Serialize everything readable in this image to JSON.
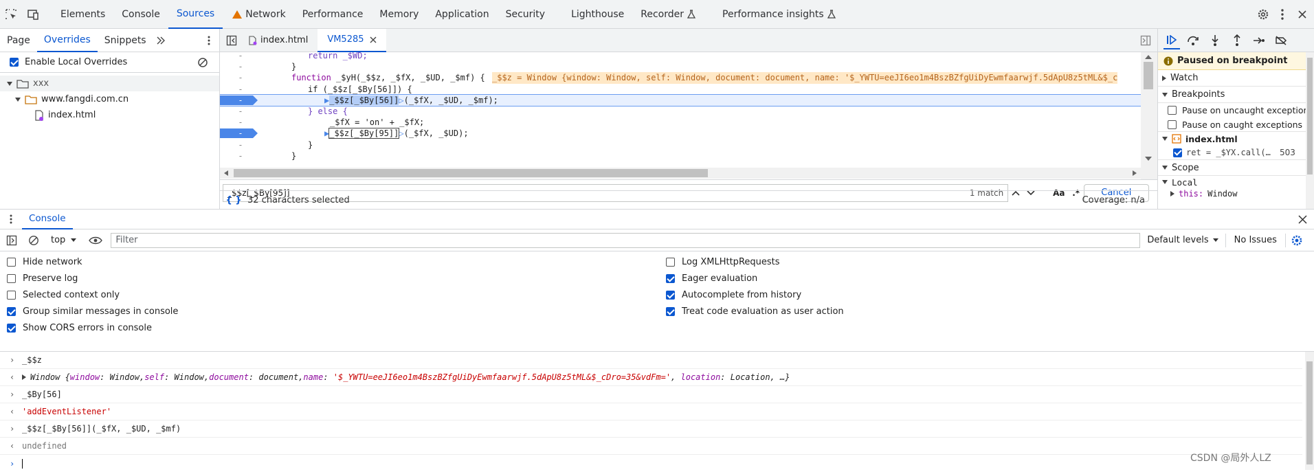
{
  "topbar": {
    "tabs": [
      "Elements",
      "Console",
      "Sources",
      "Network",
      "Performance",
      "Memory",
      "Application",
      "Security",
      "Lighthouse",
      "Recorder",
      "Performance insights"
    ],
    "active_tab": "Sources"
  },
  "navigator": {
    "tabs": [
      "Page",
      "Overrides",
      "Snippets"
    ],
    "enable_overrides_label": "Enable Local Overrides",
    "tree": {
      "root": "xxx",
      "folder": "www.fangdi.com.cn",
      "file": "index.html"
    }
  },
  "editor": {
    "tabs": [
      "index.html",
      "VM5285"
    ],
    "gutter_mark": "-",
    "lines": {
      "l1": "return _$WD;",
      "l2": "}",
      "l3_kw": "function",
      "l3_name": " _$yH(_$$z, _$fX, _$UD, _$mf) {",
      "l3_inline": "_$$z = Window {window: Window, self: Window, document: document, name: '$_YWTU=eeJI6eo1m4BszBZfgUiDyEwmfaarwjf.5dApU8z5tML&$_c",
      "l4": "if (_$$z[_$By[56]]) {",
      "l5_sel": "_$$z[_$By[56]]",
      "l5_rest": "(_$fX, _$UD, _$mf);",
      "l6": "} else {",
      "l7": "_$fX = 'on' + _$fX;",
      "l8_sel": "_$$z[_$By[95]]",
      "l8_rest": "(_$fX, _$UD);",
      "l9": "}",
      "l10": "}"
    },
    "search": {
      "value": "_$$z[_$By[95]]",
      "match_count": "1 match",
      "case_btn": "Aa",
      "regex_btn": ".*",
      "cancel_label": "Cancel"
    },
    "status": {
      "selected": "32 characters selected",
      "coverage": "Coverage: n/a",
      "pretty": "{ }"
    }
  },
  "debugger": {
    "paused": "Paused on breakpoint",
    "watch": "Watch",
    "breakpoints": "Breakpoints",
    "pause_uncaught": "Pause on uncaught exceptions",
    "pause_caught": "Pause on caught exceptions",
    "bp_file": "index.html",
    "bp_code": "ret = _$YX.call(…",
    "bp_line": "503",
    "scope": "Scope",
    "local": "Local",
    "this_key": "this:",
    "this_val": "Window"
  },
  "drawer": {
    "tab": "Console"
  },
  "console_toolbar": {
    "context": "top",
    "filter_placeholder": "Filter",
    "levels": "Default levels",
    "issues": "No Issues"
  },
  "console_settings": {
    "left": [
      {
        "label": "Hide network",
        "checked": false
      },
      {
        "label": "Preserve log",
        "checked": false
      },
      {
        "label": "Selected context only",
        "checked": false
      },
      {
        "label": "Group similar messages in console",
        "checked": true
      },
      {
        "label": "Show CORS errors in console",
        "checked": true
      }
    ],
    "right": [
      {
        "label": "Log XMLHttpRequests",
        "checked": false
      },
      {
        "label": "Eager evaluation",
        "checked": true
      },
      {
        "label": "Autocomplete from history",
        "checked": true
      },
      {
        "label": "Treat code evaluation as user action",
        "checked": true
      }
    ]
  },
  "console_log": {
    "in1": "_$$z",
    "out1_head": "Window {",
    "out1_k1": "window",
    "out1_v1": ": Window, ",
    "out1_k2": "self",
    "out1_v2": ": Window, ",
    "out1_k3": "document",
    "out1_v3": ": document, ",
    "out1_k4": "name",
    "out1_v4": "'$_YWTU=eeJI6eo1m4BszBZfgUiDyEwmfaarwjf.5dApU8z5tML&$_cDro=35&vdFm='",
    "out1_k5": "location",
    "out1_tail": ": Location, …}",
    "in2": "_$By[56]",
    "out2": "'addEventListener'",
    "in3": "_$$z[_$By[56]](_$fX, _$UD, _$mf)",
    "out3": "undefined",
    "watermark": "CSDN @局外人LZ"
  },
  "colors": {
    "accent": "#0b57d0",
    "breakpoint": "#4a86e8",
    "string": "#c80000"
  }
}
